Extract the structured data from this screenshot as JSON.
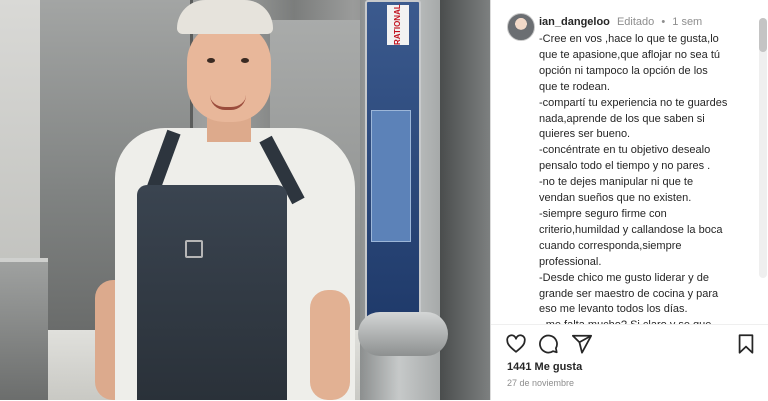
{
  "post": {
    "username": "ian_dangeloo",
    "edited_label": "Editado",
    "separator": "•",
    "time_ago": "1 sem",
    "caption_lines": [
      "-Cree en vos ,hace lo que te gusta,lo",
      "que te apasione,que aflojar no sea tú",
      "opción ni tampoco la opción de los",
      "que te rodean.",
      "-compartí tu experiencia no te guardes",
      "nada,aprende de los que saben si",
      "quieres ser bueno.",
      "-concéntrate en tu objetivo desealo",
      "pensalo todo el tiempo y no pares .",
      "-no te dejes manipular ni que te",
      "vendan sueños que no existen.",
      "-siempre seguro firme con",
      "criterio,humildad y callandose la boca",
      "cuando corresponda,siempre",
      "professional.",
      "-Desde chico me gusto liderar y de",
      "grande ser maestro de cocina y para",
      "eso me levanto todos los días.",
      "- me falta mucho? Si claro y se que"
    ],
    "likes_text": "1441 Me gusta",
    "date_text": "27 de noviembre"
  },
  "photo": {
    "oven_brand": "RATIONAL"
  },
  "icons": {
    "like": "heart-icon",
    "comment": "comment-icon",
    "share": "share-icon",
    "save": "bookmark-icon"
  }
}
